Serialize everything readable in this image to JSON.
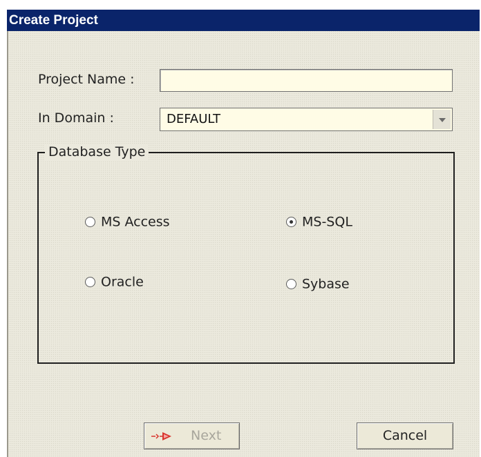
{
  "window": {
    "title": "Create Project"
  },
  "form": {
    "project_name_label": "Project Name :",
    "project_name_value": "",
    "domain_label": "In Domain :",
    "domain_selected": "DEFAULT"
  },
  "database_type": {
    "legend": "Database Type",
    "options": [
      {
        "label": "MS Access",
        "selected": false
      },
      {
        "label": "MS-SQL",
        "selected": true
      },
      {
        "label": "Oracle",
        "selected": false
      },
      {
        "label": "Sybase",
        "selected": false
      }
    ]
  },
  "buttons": {
    "next_label": "Next",
    "next_enabled": false,
    "cancel_label": "Cancel"
  },
  "colors": {
    "titlebar": "#0a246a",
    "dialog_background": "#ebe9dd",
    "input_background": "#fffce6",
    "disabled_text": "#a8a69c",
    "next_icon": "#d8322a"
  },
  "icons": {
    "next": "red-arrow-icon",
    "dropdown": "chevron-down-icon"
  }
}
